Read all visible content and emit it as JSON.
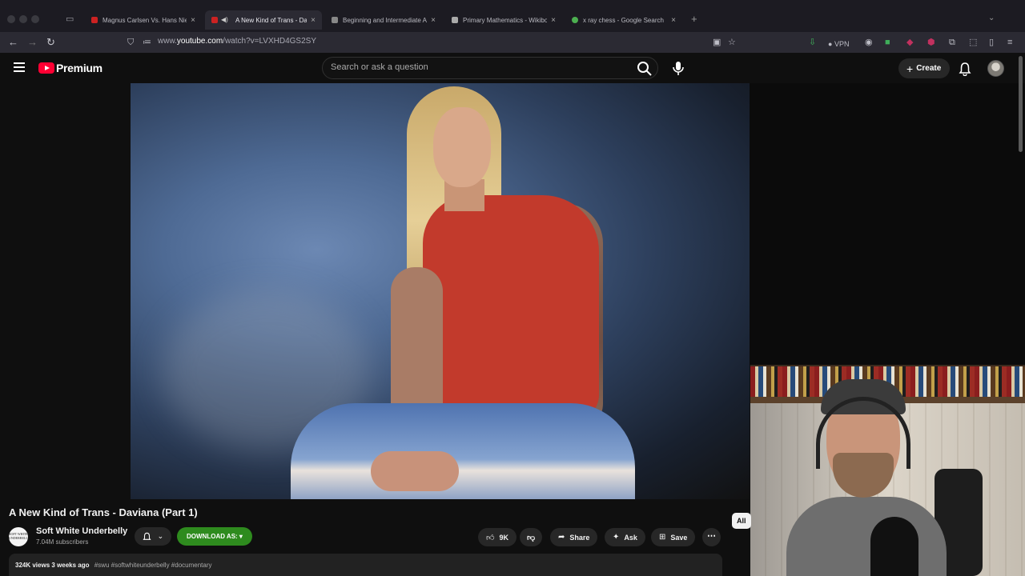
{
  "browser": {
    "tabs": [
      {
        "label": "Magnus Carlsen Vs. Hans Niem",
        "favicon_color": "#cc2222"
      },
      {
        "label": "A New Kind of Trans - Davia",
        "favicon_color": "#cc2222"
      },
      {
        "label": "Beginning and Intermediate Alg",
        "favicon_color": "#888888"
      },
      {
        "label": "Primary Mathematics - Wikiboo",
        "favicon_color": "#aaaaaa"
      },
      {
        "label": "x ray chess - Google Search",
        "favicon_color": "#4caf50"
      }
    ],
    "new_tab_symbol": "+",
    "url_prefix": "www.",
    "url_domain": "youtube.com",
    "url_path": "/watch?v=LVXHD4GS2SY",
    "vpn_label": "VPN"
  },
  "youtube": {
    "brand": "Premium",
    "search_placeholder": "Search or ask a question",
    "create_label": "Create"
  },
  "video": {
    "title": "A New Kind of Trans - Daviana (Part 1)",
    "channel_name": "Soft White Underbelly",
    "channel_avatar_text": "SOFT WHITE UNDERBELLY",
    "subscribers": "7.04M subscribers",
    "download_label": "DOWNLOAD AS: ▾",
    "likes": "9K",
    "share_label": "Share",
    "ask_label": "Ask",
    "save_label": "Save",
    "views_date": "324K views  3 weeks ago",
    "tags": "#swu #softwhiteunderbelly #documentary",
    "filter_chip": "All"
  },
  "colors": {
    "youtube_red": "#ff0033",
    "download_green": "#2e8b1e",
    "page_bg": "#0f0f0f"
  }
}
